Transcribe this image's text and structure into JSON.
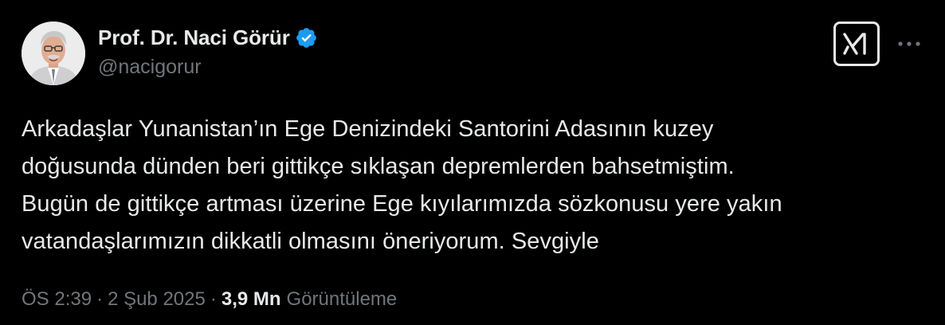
{
  "author": {
    "display_name": "Prof. Dr. Naci Görür",
    "handle": "@nacigorur",
    "verified": true,
    "avatar_icon": "profile-photo"
  },
  "actions": {
    "grok_icon": "grok-icon",
    "more_icon": "more-horizontal-icon"
  },
  "tweet": {
    "text": "Arkadaşlar Yunanistan’ın Ege Denizindeki Santorini Adasının kuzey\ndoğusunda dünden beri gittikçe sıklaşan depremlerden bahsetmiştim.\nBugün de gittikçe artması üzerine Ege kıyılarımızda sözkonusu yere yakın\nvatandaşlarımızın dikkatli olmasını öneriyorum. Sevgiyle"
  },
  "meta": {
    "time": "ÖS 2:39",
    "separator": "·",
    "date": "2 Şub 2025",
    "views_count": "3,9 Mn",
    "views_label": "Görüntüleme"
  },
  "colors": {
    "background": "#000000",
    "text_primary": "#e7e9ea",
    "text_secondary": "#71767b",
    "verified_blue": "#1d9bf0"
  }
}
